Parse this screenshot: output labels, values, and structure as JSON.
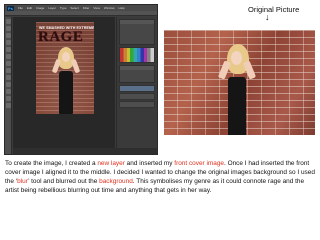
{
  "photoshop": {
    "logo": "Ps",
    "menu": [
      "File",
      "Edit",
      "Image",
      "Layer",
      "Type",
      "Select",
      "Filter",
      "View",
      "Window",
      "Help"
    ],
    "document": {
      "tagline": "WE SMASHED WITH EXTREME VOLUME!",
      "masthead": "RAGE"
    }
  },
  "original_picture": {
    "label": "Original Picture",
    "arrow": "↓"
  },
  "description": {
    "p1": "To create the image, I created a ",
    "hl1": "new layer",
    "p2": " and inserted my ",
    "hl2": "front cover image",
    "p3": ". Once I had inserted the front cover image  I aligned it to the middle. I decided I wanted to change the original images background so I used the ‘",
    "hl3": "blur",
    "p4": "’ tool and blurred out the ",
    "hl4": "background",
    "p5": ". This symbolises my genre as it could connote rage and the artist being rebellious blurring out time and anything that gets in her way."
  },
  "colors": {
    "highlight": "#e0301e",
    "ps_ui": "#3c3c3c",
    "brick": "#9a4e3c"
  }
}
